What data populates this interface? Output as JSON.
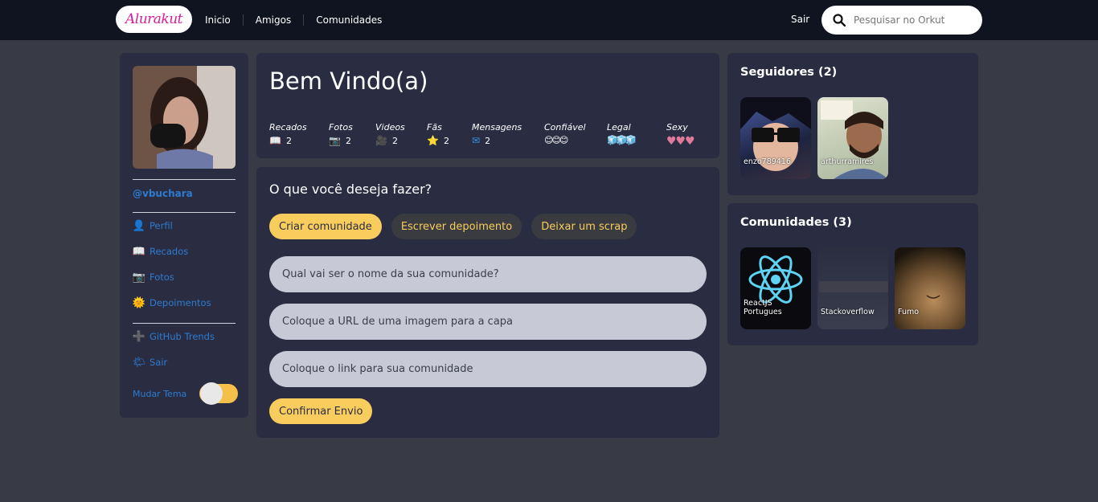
{
  "header": {
    "logo": "Alurakut",
    "nav": [
      "Inicio",
      "Amigos",
      "Comunidades"
    ],
    "exit": "Sair",
    "search_placeholder": "Pesquisar no Orkut",
    "accent": "#d81d99"
  },
  "sidebar": {
    "username": "@vbuchara",
    "items": [
      {
        "label": "Perfil",
        "icon": "user-icon",
        "glyph": "👤"
      },
      {
        "label": "Recados",
        "icon": "book-icon",
        "glyph": "📖"
      },
      {
        "label": "Fotos",
        "icon": "camera-icon",
        "glyph": "📷"
      },
      {
        "label": "Depoimentos",
        "icon": "sun-icon",
        "glyph": "🌞"
      }
    ],
    "extra": [
      {
        "label": "GitHub Trends",
        "icon": "plus-icon",
        "glyph": "➕"
      },
      {
        "label": "Sair",
        "icon": "exit-icon",
        "glyph": "🌤"
      }
    ],
    "theme_label": "Mudar Tema"
  },
  "welcome": {
    "title": "Bem Vindo(a)",
    "stats": [
      {
        "label": "Recados",
        "glyph": "📖",
        "value": "2"
      },
      {
        "label": "Fotos",
        "glyph": "📷",
        "value": "2"
      },
      {
        "label": "Videos",
        "glyph": "🎥",
        "value": "2"
      },
      {
        "label": "Fãs",
        "glyph": "⭐",
        "value": "2"
      },
      {
        "label": "Mensagens",
        "glyph": "✉",
        "value": "2"
      },
      {
        "label": "Confiável",
        "glyph": "😊😊😊",
        "value": ""
      },
      {
        "label": "Legal",
        "glyph": "🧊🧊🧊",
        "value": ""
      },
      {
        "label": "Sexy",
        "glyph": "♥♥♥",
        "value": ""
      }
    ]
  },
  "form": {
    "title": "O que você deseja fazer?",
    "actions": [
      "Criar comunidade",
      "Escrever depoimento",
      "Deixar um scrap"
    ],
    "fields": [
      "Qual vai ser o nome da sua comunidade?",
      "Coloque a URL de uma imagem para a capa",
      "Coloque o link para sua comunidade"
    ],
    "submit": "Confirmar Envio"
  },
  "followers": {
    "title": "Seguidores (2)",
    "items": [
      "enzo789416",
      "arthurramires"
    ]
  },
  "communities": {
    "title": "Comunidades (3)",
    "items": [
      "ReactJS Portugues",
      "Stackoverflow",
      "Fumo"
    ]
  },
  "colors": {
    "background": "#383b45",
    "panel": "#2a2d42",
    "primary_button": "#f9cd5d",
    "link": "#2e7bcf"
  }
}
